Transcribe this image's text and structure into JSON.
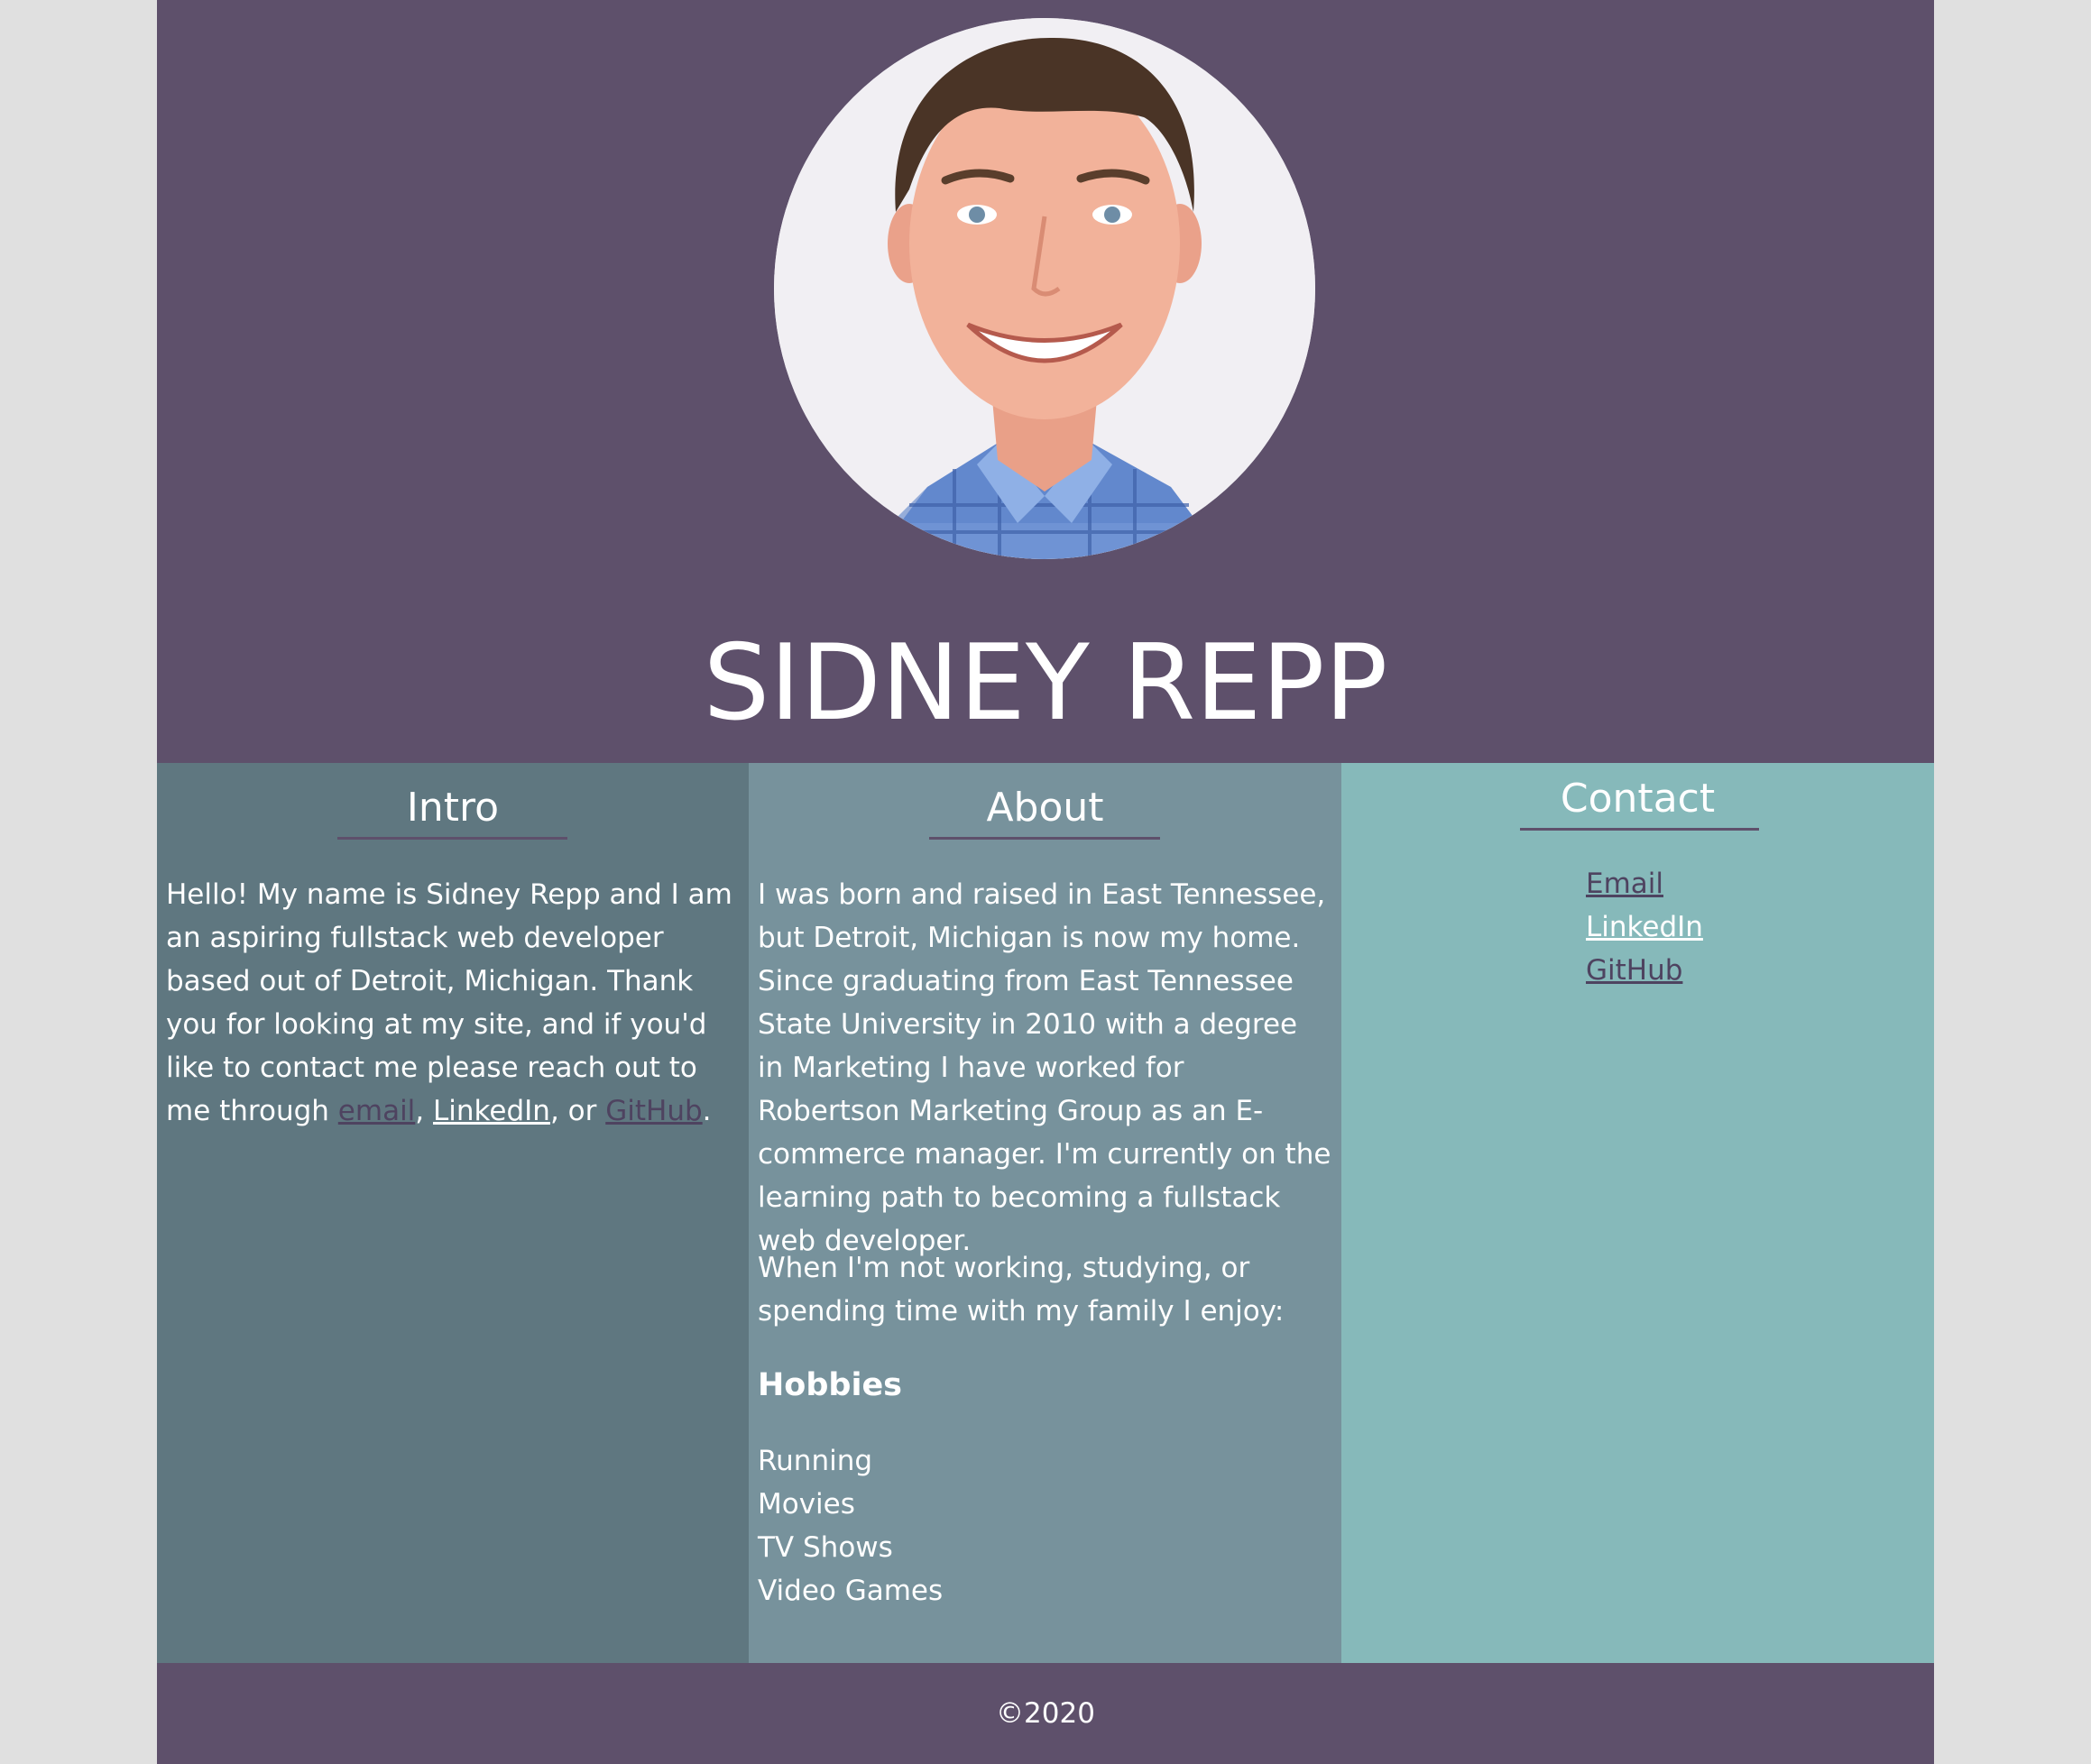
{
  "header": {
    "name": "SIDNEY REPP",
    "avatar_alt": "Sidney Repp profile photo"
  },
  "intro": {
    "heading": "Intro",
    "text_before": "Hello! My name is Sidney Repp and I am an aspiring fullstack web developer based out of Detroit, Michigan. Thank you for looking at my site, and if you'd like to contact me please reach out to me through ",
    "link_email": "email",
    "sep1": ", ",
    "link_linkedin": "LinkedIn",
    "sep2": ", or ",
    "link_github": "GitHub",
    "text_after": "."
  },
  "about": {
    "heading": "About",
    "paragraph1": "I was born and raised in East Tennessee, but Detroit, Michigan is now my home. Since graduating from East Tennessee State University in 2010 with a degree in Marketing I have worked for Robertson Marketing Group as an E-commerce manager. I'm currently on the learning path to becoming a fullstack web developer.",
    "paragraph2": "When I'm not working, studying, or spending time with my family I enjoy:",
    "hobbies_heading": "Hobbies",
    "hobbies": [
      "Running",
      "Movies",
      "TV Shows",
      "Video Games"
    ]
  },
  "contact": {
    "heading": "Contact",
    "links": [
      "Email",
      "LinkedIn",
      "GitHub"
    ]
  },
  "footer": {
    "copyright": "©2020"
  },
  "colors": {
    "header_bg": "#5e506b",
    "intro_bg": "#5f7780",
    "about_bg": "#77929c",
    "contact_bg": "#86b9ba",
    "link_dark": "#4e4360"
  }
}
